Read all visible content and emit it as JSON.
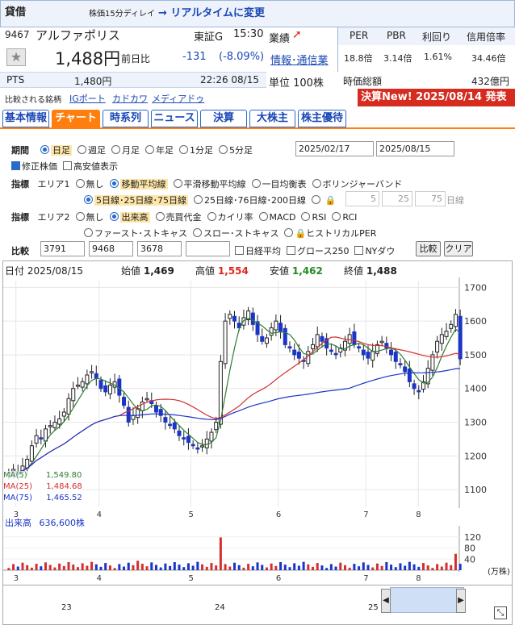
{
  "header": {
    "market_type": "貸借",
    "delay_note": "株価15分ディレイ",
    "realtime_link": "→ リアルタイムに変更",
    "code": "9467",
    "name": "アルファポリス",
    "exchange": "東証G",
    "time": "15:30",
    "price": "1,488円",
    "change_label": "前日比",
    "change": "-131",
    "change_pct": "(-8.09%)",
    "pts_label": "PTS",
    "pts_price": "1,480円",
    "pts_time": "22:26 08/15",
    "industry_label": "業績",
    "industry_link": "情報･通信業",
    "unit": "単位 100株",
    "per_label": "PER",
    "pbr_label": "PBR",
    "yield_label": "利回り",
    "margin_label": "信用倍率",
    "per": "18.8倍",
    "pbr": "3.14倍",
    "yield": "1.61%",
    "margin": "34.46倍",
    "mcap_label": "時価総額",
    "mcap": "432億円",
    "compare_label": "比較される銘柄",
    "compare_links": [
      "IGポート",
      "カドカワ",
      "メディアドゥ"
    ],
    "earnings_banner": "決算New! 2025/08/14 発表"
  },
  "tabs": [
    "基本情報",
    "チャート",
    "時系列",
    "ニュース",
    "決算",
    "大株主",
    "株主優待"
  ],
  "controls": {
    "period_label": "期間",
    "periods": [
      "日足",
      "週足",
      "月足",
      "年足",
      "1分足",
      "5分足"
    ],
    "date_from": "2025/02/17",
    "date_to": "2025/08/15",
    "adjusted": "修正株価",
    "hl_show": "高安値表示",
    "indicator_label": "指標",
    "area1_label": "エリア1",
    "area1_opts": [
      "無し",
      "移動平均線",
      "平滑移動平均線",
      "一目均衡表",
      "ボリンジャーバンド"
    ],
    "ma_opts": [
      "5日線･25日線･75日線",
      "25日線･76日線･200日線"
    ],
    "ma_custom": [
      "5",
      "25",
      "75"
    ],
    "ma_unit": "日線",
    "area2_label": "エリア2",
    "area2_opts": [
      "無し",
      "出来高",
      "売買代金",
      "カイリ率",
      "MACD",
      "RSI",
      "RCI"
    ],
    "area2_opts2": [
      "ファースト･ストキャス",
      "スロー･ストキャス",
      "ヒストリカルPER"
    ],
    "compare_label": "比較",
    "compare_codes": [
      "3791",
      "9468",
      "3678",
      ""
    ],
    "compare_checks": [
      "日経平均",
      "グロース250",
      "NYダウ"
    ],
    "compare_btn": "比較",
    "clear_btn": "クリア"
  },
  "ohlc_bar": {
    "date_label": "日付",
    "date": "2025/08/15",
    "open_label": "始値",
    "open": "1,469",
    "high_label": "高値",
    "high": "1,554",
    "low_label": "安値",
    "low": "1,462",
    "close_label": "終値",
    "close": "1,488"
  },
  "ma_legend": [
    {
      "label": "MA(5)",
      "value": "1,549.80",
      "color": "#2e7d32"
    },
    {
      "label": "MA(25)",
      "value": "1,484.68",
      "color": "#d32f2f"
    },
    {
      "label": "MA(75)",
      "value": "1,465.52",
      "color": "#1a35c8"
    }
  ],
  "volume_label": "出来高",
  "volume_value": "636,600株",
  "volume_unit": "(万株)",
  "navigator_labels": [
    "23",
    "24",
    "25"
  ],
  "chart_data": {
    "type": "candlestick",
    "ylim": [
      1050,
      1720
    ],
    "yticks": [
      1100,
      1200,
      1300,
      1400,
      1500,
      1600,
      1700
    ],
    "months": [
      "3",
      "4",
      "5",
      "6",
      "7",
      "8"
    ],
    "close_series": [
      1150,
      1160,
      1145,
      1170,
      1190,
      1230,
      1260,
      1250,
      1280,
      1290,
      1300,
      1310,
      1330,
      1370,
      1400,
      1410,
      1420,
      1440,
      1450,
      1430,
      1400,
      1390,
      1410,
      1420,
      1380,
      1350,
      1300,
      1320,
      1340,
      1360,
      1370,
      1355,
      1330,
      1320,
      1300,
      1290,
      1280,
      1260,
      1250,
      1240,
      1230,
      1220,
      1230,
      1250,
      1270,
      1300,
      1480,
      1600,
      1620,
      1600,
      1580,
      1610,
      1630,
      1590,
      1560,
      1540,
      1550,
      1580,
      1600,
      1570,
      1530,
      1520,
      1500,
      1490,
      1480,
      1510,
      1530,
      1560,
      1540,
      1520,
      1510,
      1500,
      1520,
      1540,
      1560,
      1530,
      1520,
      1500,
      1490,
      1510,
      1530,
      1540,
      1520,
      1500,
      1480,
      1470,
      1450,
      1420,
      1400,
      1390,
      1420,
      1460,
      1500,
      1540,
      1560,
      1570,
      1590,
      1620,
      1488
    ],
    "volume_ylim": [
      0,
      160
    ],
    "volume_ticks": [
      40,
      80,
      120
    ]
  }
}
